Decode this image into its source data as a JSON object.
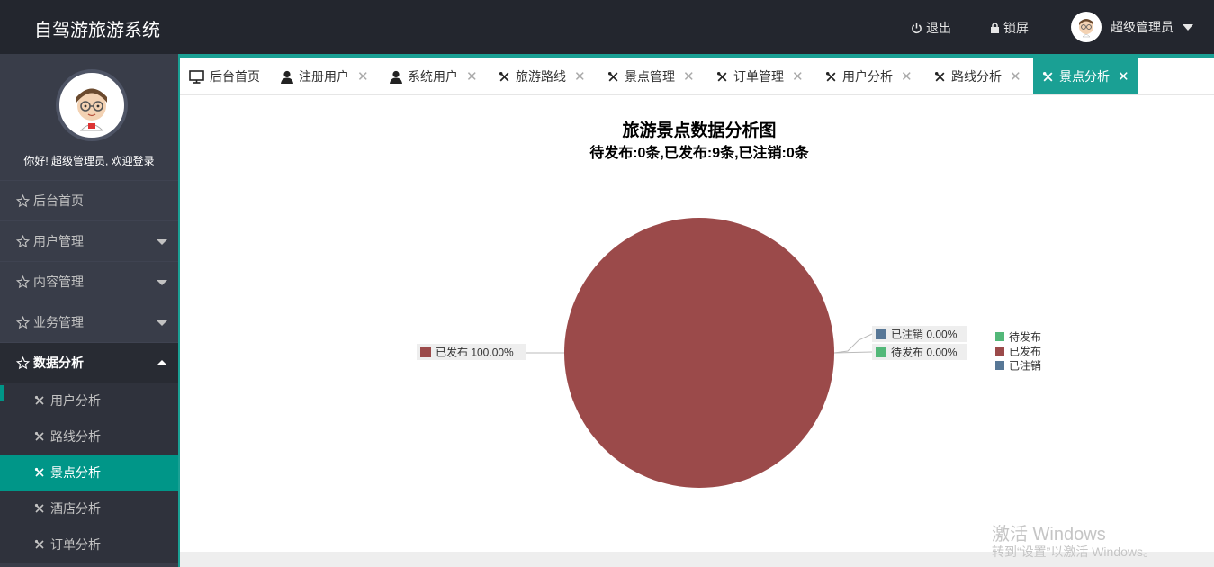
{
  "header": {
    "brand": "自驾游旅游系统",
    "logout": "退出",
    "lock": "锁屏",
    "user": "超级管理员"
  },
  "sidebar": {
    "welcome": "你好! 超级管理员, 欢迎登录",
    "menu": [
      {
        "label": "后台首页"
      },
      {
        "label": "用户管理"
      },
      {
        "label": "内容管理"
      },
      {
        "label": "业务管理"
      },
      {
        "label": "数据分析"
      }
    ],
    "submenu": [
      {
        "label": "用户分析"
      },
      {
        "label": "路线分析"
      },
      {
        "label": "景点分析"
      },
      {
        "label": "酒店分析"
      },
      {
        "label": "订单分析"
      }
    ]
  },
  "tabs": [
    {
      "label": "后台首页",
      "icon": "monitor-icon"
    },
    {
      "label": "注册用户",
      "icon": "user-icon"
    },
    {
      "label": "系统用户",
      "icon": "user-icon"
    },
    {
      "label": "旅游路线",
      "icon": "tools-icon"
    },
    {
      "label": "景点管理",
      "icon": "tools-icon"
    },
    {
      "label": "订单管理",
      "icon": "tools-icon"
    },
    {
      "label": "用户分析",
      "icon": "tools-icon"
    },
    {
      "label": "路线分析",
      "icon": "tools-icon"
    },
    {
      "label": "景点分析",
      "icon": "tools-icon"
    }
  ],
  "chart_data": {
    "type": "pie",
    "title": "旅游景点数据分析图",
    "subtitle": "待发布:0条,已发布:9条,已注销:0条",
    "slices": [
      {
        "name": "待发布",
        "value": 0,
        "label": "待发布 0.00%",
        "color": "#53b879"
      },
      {
        "name": "已发布",
        "value": 9,
        "label": "已发布 100.00%",
        "color": "#9b4a4a"
      },
      {
        "name": "已注销",
        "value": 0,
        "label": "已注销 0.00%",
        "color": "#577796"
      }
    ],
    "legend": [
      "待发布",
      "已发布",
      "已注销"
    ],
    "legend_position": "right"
  },
  "watermark": {
    "line1": "激活 Windows",
    "line2": "转到“设置”以激活 Windows。"
  },
  "colors": {
    "accent": "#1aa094",
    "header_bg": "#23262e",
    "sidebar_bg": "#393d49"
  }
}
